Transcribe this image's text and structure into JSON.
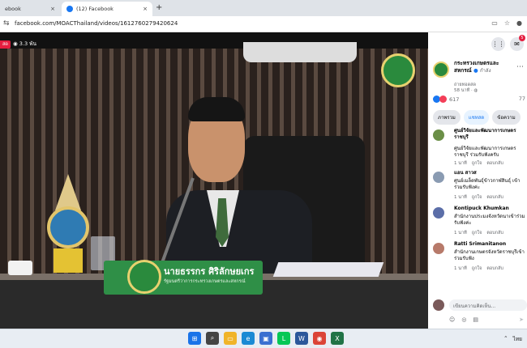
{
  "browser": {
    "tabs": [
      {
        "label": "ebook",
        "close": "×"
      },
      {
        "label": "(12) Facebook",
        "close": "×"
      }
    ],
    "new_tab": "+",
    "url": "facebook.com/MOACThailand/videos/1612760279420624"
  },
  "video": {
    "live_badge": "สด",
    "viewer_count": "3.3 พัน",
    "nameplate_name": "นายธรรกร ศิริลักษยเกร",
    "nameplate_title": "รัฐมนตรีว่าการกระทรวงเกษตรและสหกรณ์"
  },
  "sidebar": {
    "icons": [
      {
        "name": "apps-grid-icon",
        "glyph": "⋮⋮"
      },
      {
        "name": "messenger-icon",
        "glyph": "✉",
        "badge": "5"
      }
    ],
    "page": {
      "name": "กระทรวงเกษตรและสหกรณ์",
      "live": "กำลัง",
      "sub": "ถ่ายทอดสด",
      "time": "58 นาที ·"
    },
    "reactions": {
      "count": "617",
      "right": "77"
    },
    "chips": [
      "ภาพรวม",
      "แชทสด",
      "ข้อความ"
    ],
    "comments": [
      {
        "name": "ศูนย์วิจัยและพัฒนาการเกษตรราชบุรี",
        "text": "ศูนย์วิจัยและพัฒนาการเกษตรราชบุรี ร่วมรับฟังครับ",
        "avatar_color": "#6b8f47",
        "time": "1 นาที",
        "like": "ถูกใจ",
        "reply": "ตอบกลับ"
      },
      {
        "name": "แอน สาวส",
        "text": "ศูนย์เมล็ดพันธุ์ข้าวกาฬสินธุ์ เข้าร่วมรับฟังค่ะ",
        "avatar_color": "#8a9bb2",
        "time": "1 นาที",
        "like": "ถูกใจ",
        "reply": "ตอบกลับ"
      },
      {
        "name": "Kontipuck Khumkan",
        "text": "สำนักงานประมงจังหวัดนาเข้าร่วมรับฟังค่ะ",
        "avatar_color": "#5b6ea8",
        "time": "1 นาที",
        "like": "ถูกใจ",
        "reply": "ตอบกลับ"
      },
      {
        "name": "Ratti Srimanitanon",
        "text": "สำนักงานเกษตรจังหวัดราชบุรีเข้าร่วมรับฟัง",
        "avatar_color": "#b77a6a",
        "time": "1 นาที",
        "like": "ถูกใจ",
        "reply": "ตอบกลับ"
      }
    ],
    "comment_input": {
      "placeholder": "เขียนความคิดเห็น..."
    }
  },
  "taskbar": {
    "apps": [
      {
        "name": "windows-start-icon",
        "glyph": "⊞",
        "color": "#1a73e8"
      },
      {
        "name": "search-icon",
        "glyph": "⌕",
        "color": "#444444"
      },
      {
        "name": "file-explorer-icon",
        "glyph": "▭",
        "color": "#f0b429"
      },
      {
        "name": "edge-icon",
        "glyph": "e",
        "color": "#1b8ad4"
      },
      {
        "name": "store-icon",
        "glyph": "▣",
        "color": "#3a6fd0"
      },
      {
        "name": "line-icon",
        "glyph": "L",
        "color": "#06c755"
      },
      {
        "name": "word-icon",
        "glyph": "W",
        "color": "#2b579a"
      },
      {
        "name": "chrome-icon",
        "glyph": "◉",
        "color": "#db4437"
      },
      {
        "name": "excel-icon",
        "glyph": "X",
        "color": "#217346"
      }
    ],
    "lang": "ไทย"
  }
}
